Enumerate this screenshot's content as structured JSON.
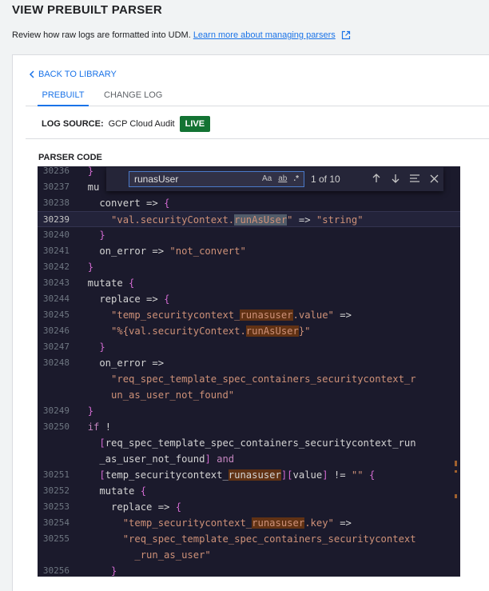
{
  "header": {
    "title": "VIEW PREBUILT PARSER",
    "description": "Review how raw logs are formatted into UDM.",
    "learn_more": "Learn more about managing parsers"
  },
  "nav": {
    "back": "BACK TO LIBRARY",
    "tabs": [
      "PREBUILT",
      "CHANGE LOG"
    ]
  },
  "log_source": {
    "label": "LOG SOURCE:",
    "value": "GCP Cloud Audit",
    "status": "LIVE"
  },
  "code_label": "PARSER CODE",
  "find": {
    "query": "runasUser",
    "case_opt": "Aa",
    "word_opt": "ab",
    "regex_opt": ".*",
    "count": "1 of 10"
  },
  "icons": {
    "external": "external-link-icon",
    "back": "chevron-left-icon",
    "prev": "arrow-up-icon",
    "next": "arrow-down-icon",
    "selection": "find-in-selection-icon",
    "close": "close-icon"
  },
  "colors": {
    "accent": "#1a73e8",
    "live": "#137333",
    "editor_bg": "#1b1a2c"
  },
  "code_lines": [
    {
      "n": "30236",
      "html": "  <span class='b'>}</span>"
    },
    {
      "n": "30237",
      "html": "  mu"
    },
    {
      "n": "30238",
      "html": "    convert => <span class='b'>{</span>"
    },
    {
      "n": "30239",
      "html": "      <span class='s'>\"val.securityContext.<span class='mc'>runAsUser</span>\"</span> => <span class='s'>\"string\"</span>"
    },
    {
      "n": "30240",
      "html": "    <span class='b'>}</span>"
    },
    {
      "n": "30241",
      "html": "    on_error => <span class='s'>\"not_convert\"</span>"
    },
    {
      "n": "30242",
      "html": "  <span class='b'>}</span>"
    },
    {
      "n": "30243",
      "html": "  mutate <span class='b'>{</span>"
    },
    {
      "n": "30244",
      "html": "    replace => <span class='b'>{</span>"
    },
    {
      "n": "30245",
      "html": "      <span class='s'>\"temp_securitycontext_<span class='m'>runasuser</span>.value\"</span> =>"
    },
    {
      "n": "30246",
      "html": "      <span class='s'>\"%{val.securityContext.<span class='m'>runAsUser</span>}\"</span>"
    },
    {
      "n": "30247",
      "html": "    <span class='b'>}</span>"
    },
    {
      "n": "30248",
      "html": "    on_error =>"
    },
    {
      "n": "",
      "html": "      <span class='s'>\"req_spec_template_spec_containers_securitycontext_r</span>"
    },
    {
      "n": "",
      "html": "      <span class='s'>un_as_user_not_found\"</span>"
    },
    {
      "n": "30249",
      "html": "  <span class='b'>}</span>"
    },
    {
      "n": "30250",
      "html": "  <span class='k'>if</span> !"
    },
    {
      "n": "",
      "html": "    <span class='b'>[</span>req_spec_template_spec_containers_securitycontext_run"
    },
    {
      "n": "",
      "html": "    _as_user_not_found<span class='b'>]</span> <span class='k'>and</span>"
    },
    {
      "n": "30251",
      "html": "    <span class='b'>[</span>temp_securitycontext_<span class='m'>runasuser</span><span class='b'>][</span>value<span class='b'>]</span> != <span class='s'>\"\"</span> <span class='b'>{</span>"
    },
    {
      "n": "30252",
      "html": "    mutate <span class='b'>{</span>"
    },
    {
      "n": "30253",
      "html": "      replace => <span class='b'>{</span>"
    },
    {
      "n": "30254",
      "html": "        <span class='s'>\"temp_securitycontext_<span class='m'>runasuser</span>.key\"</span> =>"
    },
    {
      "n": "30255",
      "html": "        <span class='s'>\"req_spec_template_spec_containers_securitycontext</span>"
    },
    {
      "n": "",
      "html": "          <span class='s'>_run_as_user\"</span>"
    },
    {
      "n": "30256",
      "html": "      <span class='b'>}</span>"
    }
  ]
}
